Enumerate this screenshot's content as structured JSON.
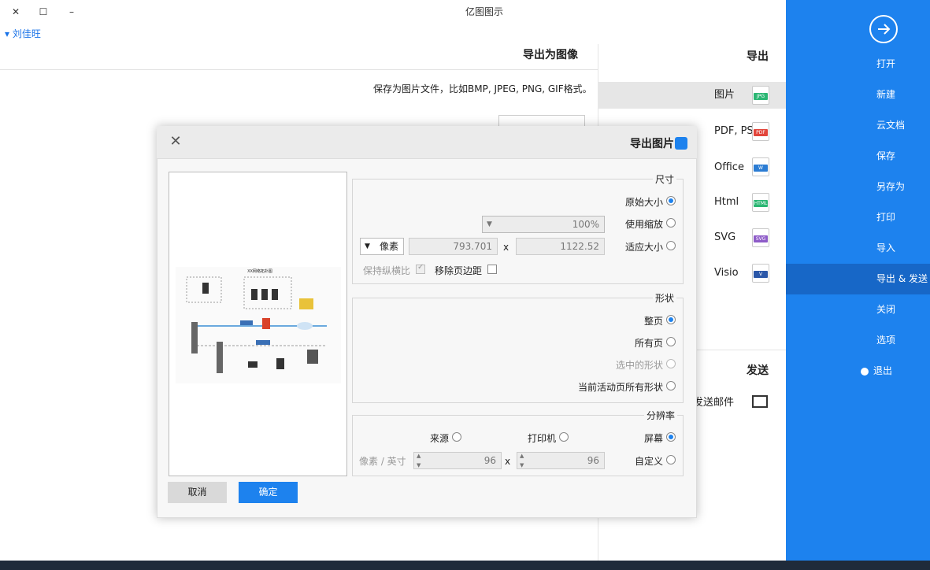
{
  "window": {
    "title": "亿图图示",
    "user_link": "刘佳旺"
  },
  "sidebar": {
    "items": [
      {
        "label": "打开"
      },
      {
        "label": "新建"
      },
      {
        "label": "云文档"
      },
      {
        "label": "保存"
      },
      {
        "label": "另存为"
      },
      {
        "label": "打印"
      },
      {
        "label": "导入"
      },
      {
        "label": "导出 & 发送"
      },
      {
        "label": "关闭"
      },
      {
        "label": "选项"
      },
      {
        "label": "退出"
      }
    ],
    "active_index": 7
  },
  "export_panel": {
    "title": "导出",
    "formats": [
      {
        "label": "图片",
        "icon": "JPG",
        "color": "#2bb673"
      },
      {
        "label": "PDF, PS,",
        "icon": "PDF",
        "color": "#e2453b"
      },
      {
        "label": "Office",
        "icon": "W",
        "color": "#2b7cd3"
      },
      {
        "label": "Html",
        "icon": "HTML",
        "color": "#2bb673"
      },
      {
        "label": "SVG",
        "icon": "SVG",
        "color": "#8e5cc8"
      },
      {
        "label": "Visio",
        "icon": "V",
        "color": "#2b57a8"
      }
    ],
    "send_title": "发送",
    "send_mail": "发送邮件"
  },
  "image_panel": {
    "title": "导出为图像",
    "description": "保存为图片文件，比如BMP, JPEG, PNG, GIF格式。"
  },
  "dialog": {
    "title": "导出图片",
    "size": {
      "label": "尺寸",
      "original": "原始大小",
      "use_zoom": "使用缩放",
      "zoom_value": "100%",
      "fit": "适应大小",
      "width": "1122.52",
      "times": "x",
      "height": "793.701",
      "unit": "像素",
      "remove_margin": "移除页边距",
      "keep_ratio": "保持纵横比"
    },
    "shape": {
      "label": "形状",
      "whole_page": "整页",
      "all_pages": "所有页",
      "selected": "选中的形状",
      "active_all": "当前活动页所有形状"
    },
    "resolution": {
      "label": "分辨率",
      "screen": "屏幕",
      "printer": "打印机",
      "source": "来源",
      "custom": "自定义",
      "x_val": "96",
      "times": "x",
      "y_val": "96",
      "unit": "像素 / 英寸"
    },
    "ok": "确定",
    "cancel": "取消",
    "preview_caption": "XX网络拓扑图"
  }
}
